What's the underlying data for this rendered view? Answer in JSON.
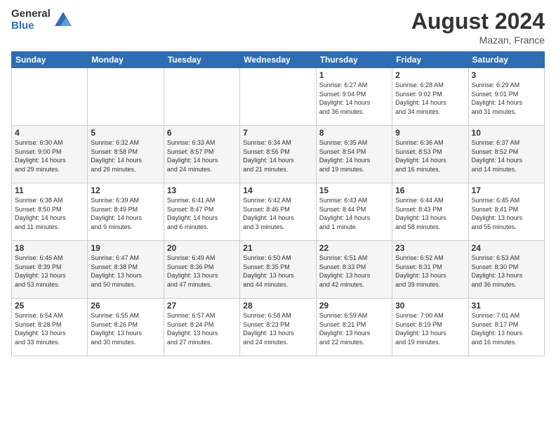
{
  "logo": {
    "general": "General",
    "blue": "Blue"
  },
  "header": {
    "month": "August 2024",
    "location": "Mazan, France"
  },
  "weekdays": [
    "Sunday",
    "Monday",
    "Tuesday",
    "Wednesday",
    "Thursday",
    "Friday",
    "Saturday"
  ],
  "weeks": [
    [
      {
        "day": "",
        "info": ""
      },
      {
        "day": "",
        "info": ""
      },
      {
        "day": "",
        "info": ""
      },
      {
        "day": "",
        "info": ""
      },
      {
        "day": "1",
        "info": "Sunrise: 6:27 AM\nSunset: 9:04 PM\nDaylight: 14 hours\nand 36 minutes."
      },
      {
        "day": "2",
        "info": "Sunrise: 6:28 AM\nSunset: 9:02 PM\nDaylight: 14 hours\nand 34 minutes."
      },
      {
        "day": "3",
        "info": "Sunrise: 6:29 AM\nSunset: 9:01 PM\nDaylight: 14 hours\nand 31 minutes."
      }
    ],
    [
      {
        "day": "4",
        "info": "Sunrise: 6:30 AM\nSunset: 9:00 PM\nDaylight: 14 hours\nand 29 minutes."
      },
      {
        "day": "5",
        "info": "Sunrise: 6:32 AM\nSunset: 8:58 PM\nDaylight: 14 hours\nand 26 minutes."
      },
      {
        "day": "6",
        "info": "Sunrise: 6:33 AM\nSunset: 8:57 PM\nDaylight: 14 hours\nand 24 minutes."
      },
      {
        "day": "7",
        "info": "Sunrise: 6:34 AM\nSunset: 8:56 PM\nDaylight: 14 hours\nand 21 minutes."
      },
      {
        "day": "8",
        "info": "Sunrise: 6:35 AM\nSunset: 8:54 PM\nDaylight: 14 hours\nand 19 minutes."
      },
      {
        "day": "9",
        "info": "Sunrise: 6:36 AM\nSunset: 8:53 PM\nDaylight: 14 hours\nand 16 minutes."
      },
      {
        "day": "10",
        "info": "Sunrise: 6:37 AM\nSunset: 8:52 PM\nDaylight: 14 hours\nand 14 minutes."
      }
    ],
    [
      {
        "day": "11",
        "info": "Sunrise: 6:38 AM\nSunset: 8:50 PM\nDaylight: 14 hours\nand 11 minutes."
      },
      {
        "day": "12",
        "info": "Sunrise: 6:39 AM\nSunset: 8:49 PM\nDaylight: 14 hours\nand 9 minutes."
      },
      {
        "day": "13",
        "info": "Sunrise: 6:41 AM\nSunset: 8:47 PM\nDaylight: 14 hours\nand 6 minutes."
      },
      {
        "day": "14",
        "info": "Sunrise: 6:42 AM\nSunset: 8:46 PM\nDaylight: 14 hours\nand 3 minutes."
      },
      {
        "day": "15",
        "info": "Sunrise: 6:43 AM\nSunset: 8:44 PM\nDaylight: 14 hours\nand 1 minute."
      },
      {
        "day": "16",
        "info": "Sunrise: 6:44 AM\nSunset: 8:43 PM\nDaylight: 13 hours\nand 58 minutes."
      },
      {
        "day": "17",
        "info": "Sunrise: 6:45 AM\nSunset: 8:41 PM\nDaylight: 13 hours\nand 55 minutes."
      }
    ],
    [
      {
        "day": "18",
        "info": "Sunrise: 6:46 AM\nSunset: 8:39 PM\nDaylight: 13 hours\nand 53 minutes."
      },
      {
        "day": "19",
        "info": "Sunrise: 6:47 AM\nSunset: 8:38 PM\nDaylight: 13 hours\nand 50 minutes."
      },
      {
        "day": "20",
        "info": "Sunrise: 6:49 AM\nSunset: 8:36 PM\nDaylight: 13 hours\nand 47 minutes."
      },
      {
        "day": "21",
        "info": "Sunrise: 6:50 AM\nSunset: 8:35 PM\nDaylight: 13 hours\nand 44 minutes."
      },
      {
        "day": "22",
        "info": "Sunrise: 6:51 AM\nSunset: 8:33 PM\nDaylight: 13 hours\nand 42 minutes."
      },
      {
        "day": "23",
        "info": "Sunrise: 6:52 AM\nSunset: 8:31 PM\nDaylight: 13 hours\nand 39 minutes."
      },
      {
        "day": "24",
        "info": "Sunrise: 6:53 AM\nSunset: 8:30 PM\nDaylight: 13 hours\nand 36 minutes."
      }
    ],
    [
      {
        "day": "25",
        "info": "Sunrise: 6:54 AM\nSunset: 8:28 PM\nDaylight: 13 hours\nand 33 minutes."
      },
      {
        "day": "26",
        "info": "Sunrise: 6:55 AM\nSunset: 8:26 PM\nDaylight: 13 hours\nand 30 minutes."
      },
      {
        "day": "27",
        "info": "Sunrise: 6:57 AM\nSunset: 8:24 PM\nDaylight: 13 hours\nand 27 minutes."
      },
      {
        "day": "28",
        "info": "Sunrise: 6:58 AM\nSunset: 8:23 PM\nDaylight: 13 hours\nand 24 minutes."
      },
      {
        "day": "29",
        "info": "Sunrise: 6:59 AM\nSunset: 8:21 PM\nDaylight: 13 hours\nand 22 minutes."
      },
      {
        "day": "30",
        "info": "Sunrise: 7:00 AM\nSunset: 8:19 PM\nDaylight: 13 hours\nand 19 minutes."
      },
      {
        "day": "31",
        "info": "Sunrise: 7:01 AM\nSunset: 8:17 PM\nDaylight: 13 hours\nand 16 minutes."
      }
    ]
  ]
}
